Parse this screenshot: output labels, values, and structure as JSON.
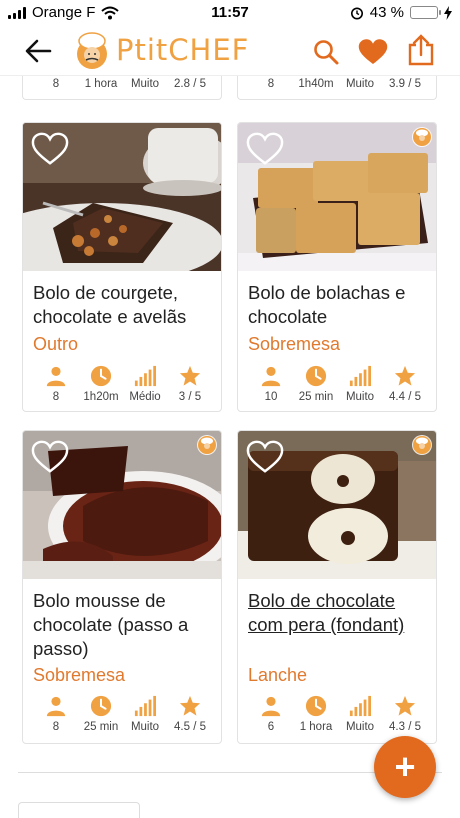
{
  "status_bar": {
    "carrier": "Orange F",
    "time": "11:57",
    "battery": "43 %",
    "battery_level": 0.43
  },
  "app": {
    "logo_text": "PtitCHEF",
    "accent_color": "#e26a1e",
    "logo_color": "#f0a142"
  },
  "previous_row": [
    {
      "servings": "8",
      "time": "1 hora",
      "difficulty": "Muito",
      "rating": "2.8 / 5"
    },
    {
      "servings": "8",
      "time": "1h40m",
      "difficulty": "Muito",
      "rating": "3.9 / 5"
    }
  ],
  "recipes": [
    {
      "title": "Bolo de courgete, chocolate e avelãs",
      "category": "Outro",
      "servings": "8",
      "time": "1h20m",
      "difficulty": "Médio",
      "rating": "3 / 5"
    },
    {
      "title": "Bolo de bolachas e chocolate",
      "category": "Sobremesa",
      "servings": "10",
      "time": "25 min",
      "difficulty": "Muito",
      "rating": "4.4 / 5"
    },
    {
      "title": "Bolo mousse de chocolate (passo a passo)",
      "category": "Sobremesa",
      "servings": "8",
      "time": "25 min",
      "difficulty": "Muito",
      "rating": "4.5 / 5"
    },
    {
      "title": "Bolo de chocolate com pera (fondant)",
      "category": "Lanche",
      "servings": "6",
      "time": "1 hora",
      "difficulty": "Muito",
      "rating": "4.3 / 5"
    }
  ],
  "fab_label": "+"
}
